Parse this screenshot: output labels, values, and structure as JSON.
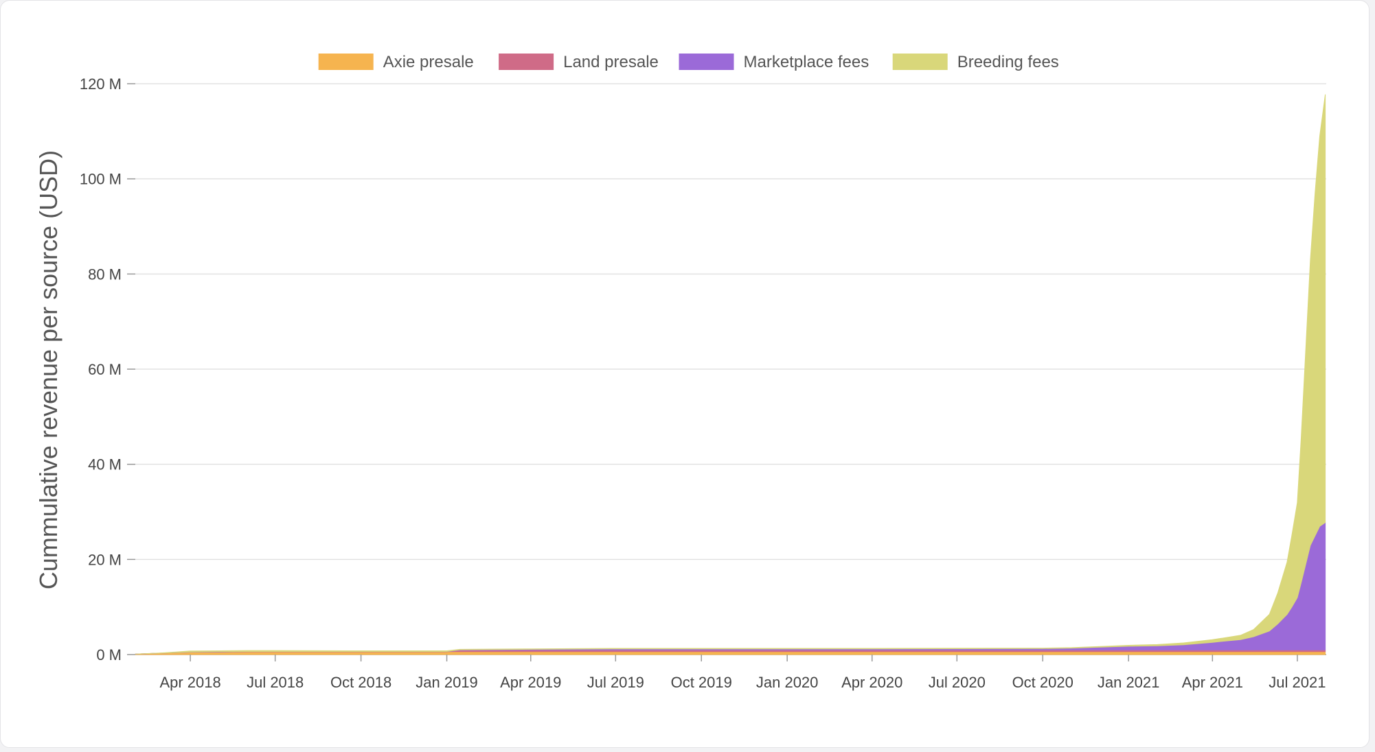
{
  "chart_data": {
    "type": "area",
    "stacked": true,
    "title": "",
    "xlabel": "",
    "ylabel": "Cummulative revenue per source (USD)",
    "ylim": [
      0,
      120000000
    ],
    "y_ticks": [
      {
        "value": 0,
        "label": "0 M"
      },
      {
        "value": 20000000,
        "label": "20 M"
      },
      {
        "value": 40000000,
        "label": "40 M"
      },
      {
        "value": 60000000,
        "label": "60 M"
      },
      {
        "value": 80000000,
        "label": "80 M"
      },
      {
        "value": 100000000,
        "label": "100 M"
      },
      {
        "value": 120000000,
        "label": "120 M"
      }
    ],
    "x_range": [
      "2018-02-01",
      "2021-08-01"
    ],
    "x_ticks": [
      {
        "date": "2018-04-01",
        "label": "Apr 2018"
      },
      {
        "date": "2018-07-01",
        "label": "Jul 2018"
      },
      {
        "date": "2018-10-01",
        "label": "Oct 2018"
      },
      {
        "date": "2019-01-01",
        "label": "Jan 2019"
      },
      {
        "date": "2019-04-01",
        "label": "Apr 2019"
      },
      {
        "date": "2019-07-01",
        "label": "Jul 2019"
      },
      {
        "date": "2019-10-01",
        "label": "Oct 2019"
      },
      {
        "date": "2020-01-01",
        "label": "Jan 2020"
      },
      {
        "date": "2020-04-01",
        "label": "Apr 2020"
      },
      {
        "date": "2020-07-01",
        "label": "Jul 2020"
      },
      {
        "date": "2020-10-01",
        "label": "Oct 2020"
      },
      {
        "date": "2021-01-01",
        "label": "Jan 2021"
      },
      {
        "date": "2021-04-01",
        "label": "Apr 2021"
      },
      {
        "date": "2021-07-01",
        "label": "Jul 2021"
      }
    ],
    "grid": true,
    "legend_position": "top-center",
    "x": [
      "2018-02-01",
      "2018-03-01",
      "2018-04-01",
      "2018-05-01",
      "2018-06-01",
      "2018-07-01",
      "2018-10-01",
      "2019-01-01",
      "2019-01-15",
      "2019-04-01",
      "2019-07-01",
      "2019-10-01",
      "2020-01-01",
      "2020-04-01",
      "2020-07-01",
      "2020-10-01",
      "2020-11-01",
      "2020-12-01",
      "2021-01-01",
      "2021-02-01",
      "2021-03-01",
      "2021-04-01",
      "2021-04-15",
      "2021-05-01",
      "2021-05-15",
      "2021-06-01",
      "2021-06-10",
      "2021-06-20",
      "2021-06-25",
      "2021-07-01",
      "2021-07-05",
      "2021-07-10",
      "2021-07-15",
      "2021-07-20",
      "2021-07-25",
      "2021-07-31"
    ],
    "series": [
      {
        "name": "Axie presale",
        "color": "#f6b44f",
        "values": [
          0.1,
          0.3,
          0.5,
          0.55,
          0.6,
          0.6,
          0.6,
          0.6,
          0.6,
          0.6,
          0.6,
          0.6,
          0.6,
          0.6,
          0.6,
          0.6,
          0.6,
          0.6,
          0.6,
          0.6,
          0.6,
          0.6,
          0.6,
          0.6,
          0.6,
          0.6,
          0.6,
          0.6,
          0.6,
          0.6,
          0.6,
          0.6,
          0.6,
          0.6,
          0.6,
          0.6
        ]
      },
      {
        "name": "Land presale",
        "color": "#cf6b87",
        "values": [
          0,
          0,
          0,
          0,
          0,
          0,
          0,
          0,
          0.3,
          0.35,
          0.35,
          0.35,
          0.35,
          0.35,
          0.35,
          0.35,
          0.35,
          0.35,
          0.35,
          0.35,
          0.35,
          0.35,
          0.35,
          0.35,
          0.35,
          0.35,
          0.35,
          0.35,
          0.35,
          0.35,
          0.35,
          0.35,
          0.35,
          0.35,
          0.35,
          0.35
        ]
      },
      {
        "name": "Marketplace fees",
        "color": "#9b6ad8",
        "values": [
          0,
          0,
          0.05,
          0.05,
          0.05,
          0.05,
          0.05,
          0.05,
          0.1,
          0.15,
          0.25,
          0.25,
          0.25,
          0.25,
          0.28,
          0.3,
          0.4,
          0.6,
          0.8,
          0.9,
          1.1,
          1.6,
          1.9,
          2.2,
          2.8,
          4.0,
          5.5,
          7.5,
          9.0,
          11.0,
          14.0,
          18.0,
          22.0,
          24.0,
          26.0,
          26.8
        ]
      },
      {
        "name": "Breeding fees",
        "color": "#d9d77a",
        "values": [
          0,
          0.05,
          0.2,
          0.2,
          0.2,
          0.2,
          0.15,
          0.15,
          0.1,
          0.1,
          0.1,
          0.1,
          0.1,
          0.1,
          0.1,
          0.1,
          0.1,
          0.15,
          0.2,
          0.25,
          0.4,
          0.6,
          0.7,
          0.9,
          1.5,
          3.5,
          6.5,
          11.0,
          15.0,
          20.0,
          30.0,
          45.0,
          60.0,
          72.0,
          82.0,
          90.0
        ]
      }
    ],
    "values_unit": "M USD"
  }
}
